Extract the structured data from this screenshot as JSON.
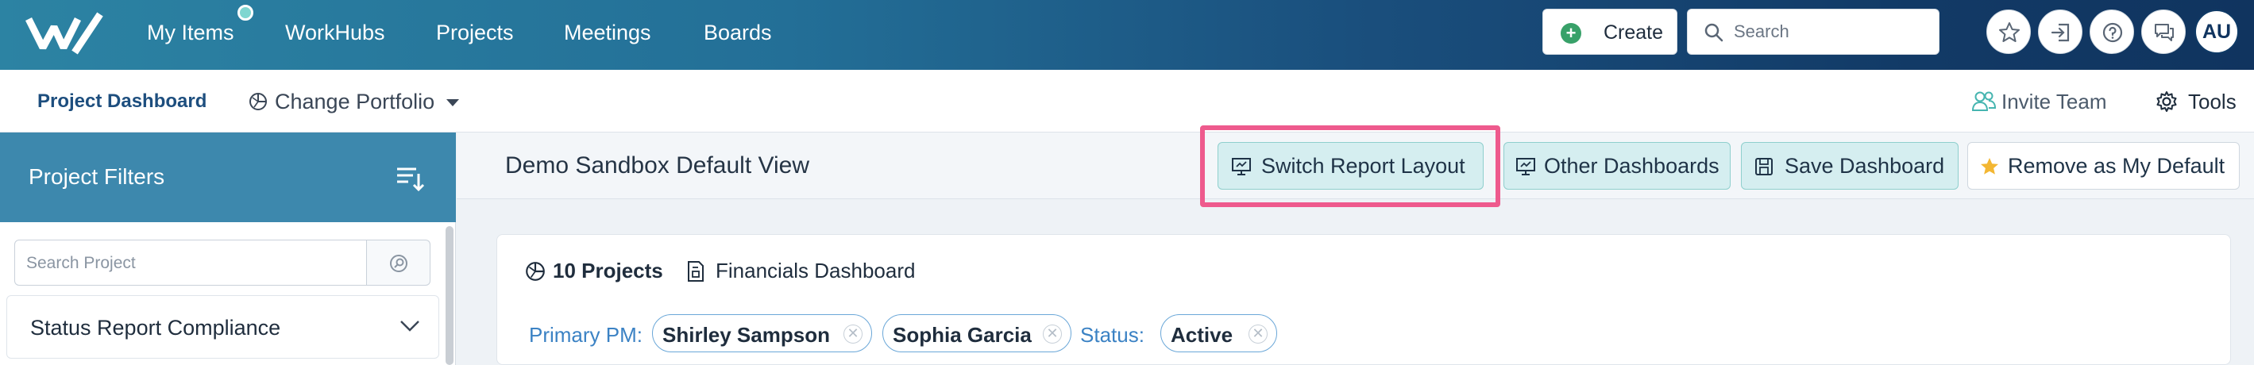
{
  "topnav": {
    "logo": "logo-icon",
    "items": [
      {
        "label": "My Items"
      },
      {
        "label": "WorkHubs"
      },
      {
        "label": "Projects"
      },
      {
        "label": "Meetings"
      },
      {
        "label": "Boards"
      }
    ],
    "create_label": "Create",
    "search_placeholder": "Search",
    "icons": [
      "star-icon",
      "sign-in-icon",
      "help-icon",
      "chat-icon"
    ],
    "avatar_initials": "AU"
  },
  "subheader": {
    "breadcrumb": "Project Dashboard",
    "change_portfolio": "Change Portfolio",
    "invite_team": "Invite Team",
    "tools": "Tools"
  },
  "sidebar": {
    "title": "Project Filters",
    "search_placeholder": "Search Project",
    "panels": [
      {
        "label": "Status Report Compliance"
      }
    ]
  },
  "main": {
    "view_title": "Demo Sandbox Default View",
    "toolbar": {
      "switch_layout": "Switch Report Layout",
      "other_dashboards": "Other Dashboards",
      "save_dashboard": "Save Dashboard",
      "remove_default": "Remove as My Default"
    },
    "summary": {
      "project_count": "10 Projects",
      "dashboard_name": "Financials Dashboard"
    },
    "filters": {
      "primary_pm_label": "Primary PM:",
      "pm_chips": [
        "Shirley Sampson",
        "Sophia Garcia"
      ],
      "status_label": "Status:",
      "status_chips": [
        "Active"
      ]
    }
  },
  "colors": {
    "highlight": "#ee5a8d",
    "accent_teal": "#d5eef0",
    "link_blue": "#3b82c4",
    "sidebar_header": "#3d88ad"
  }
}
